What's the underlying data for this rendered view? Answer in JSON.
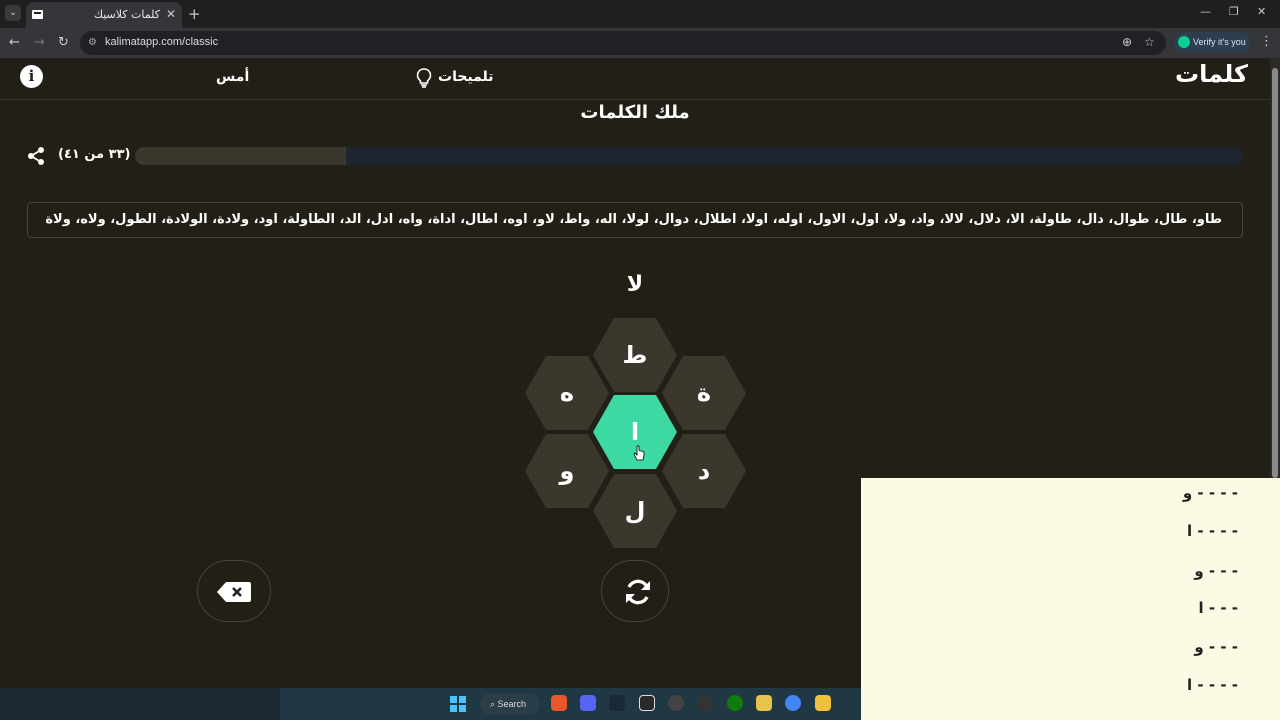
{
  "browser": {
    "tab_title": "كلمات كلاسيك",
    "url": "kalimatapp.com/classic",
    "verify_label": "Verify it's you"
  },
  "header": {
    "logo": "كلمات",
    "hints_label": "تلميحات",
    "yesterday_label": "أمس"
  },
  "game": {
    "rank_title": "ملك الكلمات",
    "progress_text": "(٣٣ من ٤١)",
    "progress_fraction": 0.19,
    "found_words": "طاو، طال، طوال، دال، طاولة، الا، دلال، لالا، واد، ولا، اول، الاول، اوله، اولا، اطلال، دوال، لولا، اله، واط، لاو، اوه، اطال، اداة، واه، ادل، الد، الطاولة، اود، ولادة، الولادة، الطول، ولاه، ولاة",
    "current_word": "لا",
    "letters": {
      "top": "ط",
      "upper_left": "ه",
      "upper_right": "ة",
      "center": "ا",
      "lower_left": "و",
      "lower_right": "د",
      "bottom": "ل"
    }
  },
  "hint_panel": {
    "rows": [
      "و - - - -",
      "ا - - - -",
      "و - - -",
      "ا - - -",
      "و - - -",
      "ا - - - -"
    ]
  },
  "taskbar": {
    "search_label": "Search"
  },
  "colors": {
    "background": "#221f17",
    "hex_cell": "#3b372c",
    "hex_center": "#3dd9a3",
    "progress_track": "#1e2430"
  }
}
